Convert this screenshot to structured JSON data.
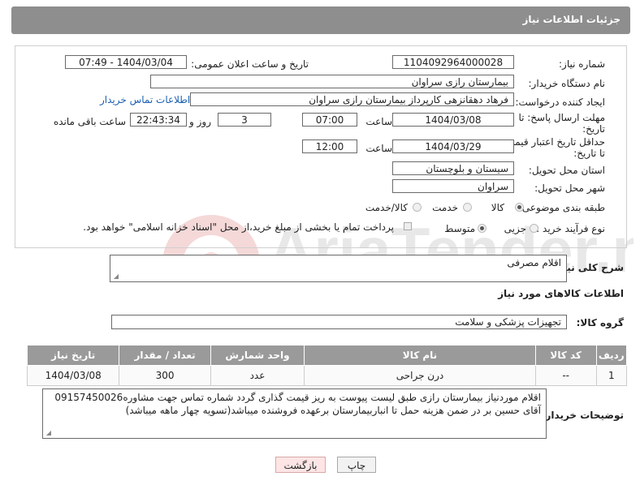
{
  "header": {
    "title": "جزئیات اطلاعات نیاز"
  },
  "fields": {
    "need_number_label": "شماره نیاز:",
    "need_number": "1104092964000028",
    "announce_label": "تاریخ و ساعت اعلان عمومی:",
    "announce_value": "1404/03/04 - 07:49",
    "buyer_org_label": "نام دستگاه خریدار:",
    "buyer_org": "بیمارستان رازی سراوان",
    "requester_label": "ایجاد کننده درخواست:",
    "requester": "فرهاد دهقانزهی کارپرداز بیمارستان رازی سراوان",
    "contact_link": "اطلاعات تماس خریدار",
    "deadline_label_1": "مهلت ارسال پاسخ: تا",
    "deadline_label_2": "تاریخ:",
    "deadline_date": "1404/03/08",
    "time_label": "ساعت",
    "deadline_time": "07:00",
    "days_value": "3",
    "days_label": "روز و",
    "remaining_value": "22:43:34",
    "remaining_label": "ساعت باقی مانده",
    "validity_label_1": "حداقل تاریخ اعتبار قیمت:",
    "validity_label_2": "تا تاریخ:",
    "validity_date": "1404/03/29",
    "validity_time": "12:00",
    "province_label": "استان محل تحویل:",
    "province": "سیستان و بلوچستان",
    "city_label": "شهر محل تحویل:",
    "city": "سراوان",
    "category_label": "طبقه بندی موضوعی:",
    "category_options": [
      "کالا",
      "خدمت",
      "کالا/خدمت"
    ],
    "process_label": "نوع فرآیند خرید :",
    "process_options": [
      "جزیی",
      "متوسط"
    ],
    "payment_note": "پرداخت تمام یا بخشی از مبلغ خرید،از محل \"اسناد خزانه اسلامی\" خواهد بود."
  },
  "description": {
    "label": "شرح کلی نیاز:",
    "value": "اقلام مصرفی"
  },
  "goods_section": {
    "title": "اطلاعات کالاهای مورد نیاز",
    "group_label": "گروه کالا:",
    "group_value": "تجهیزات پزشکی و سلامت"
  },
  "table": {
    "headers": [
      "ردیف",
      "کد کالا",
      "نام کالا",
      "واحد شمارش",
      "تعداد / مقدار",
      "تاریخ نیاز"
    ],
    "rows": [
      [
        "1",
        "--",
        "درن جراحی",
        "عدد",
        "300",
        "1404/03/08"
      ]
    ]
  },
  "buyer_notes": {
    "label": "توضیحات خریدار:",
    "value": "اقلام موردنیاز بیمارستان رازی طبق لیست پیوست به ریز قیمت گذاری گردد شماره تماس جهت مشاوره09157450026 آقای حسین بر در ضمن هزینه حمل تا انباربیمارستان برعهده فروشنده میباشد(تسویه چهار ماهه میباشد)"
  },
  "buttons": {
    "print": "چاپ",
    "back": "بازگشت"
  },
  "watermark": {
    "text": "AriaTender.neT"
  },
  "colors": {
    "header_bg": "#8e8e8e",
    "link": "#1a5fb4",
    "back_button_bg": "#fde5e5"
  }
}
